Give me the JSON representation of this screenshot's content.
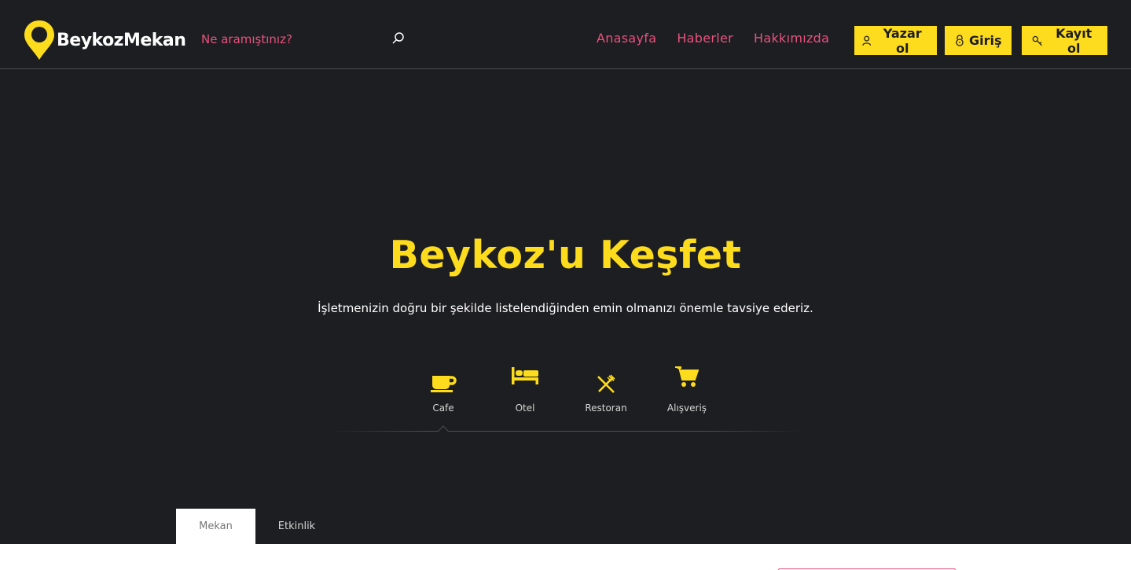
{
  "header": {
    "logo_text": "BeykozMekan",
    "search": {
      "placeholder": "Ne aramıştınız?"
    },
    "nav": [
      {
        "label": "Anasayfa"
      },
      {
        "label": "Haberler"
      },
      {
        "label": "Hakkımızda"
      }
    ],
    "buttons": {
      "writer": "Yazar ol",
      "login": "Giriş",
      "register": "Kayıt ol"
    }
  },
  "hero": {
    "title": "Beykoz'u Keşfet",
    "subtitle": "İşletmenizin doğru bir şekilde listelendiğinden emin olmanızı önemle tavsiye ederiz."
  },
  "categories": [
    {
      "label": "Cafe",
      "icon": "coffee-cup-icon",
      "selected": true
    },
    {
      "label": "Otel",
      "icon": "bed-icon"
    },
    {
      "label": "Restoran",
      "icon": "fork-knife-icon"
    },
    {
      "label": "Alışveriş",
      "icon": "shopping-cart-icon"
    }
  ],
  "tabs": [
    {
      "label": "Mekan",
      "active": true
    },
    {
      "label": "Etkinlik"
    }
  ],
  "colors": {
    "background": "#1d1e21",
    "accent_yellow": "#fddb1d",
    "accent_pink": "#e8527e",
    "text_white": "#ffffff"
  }
}
